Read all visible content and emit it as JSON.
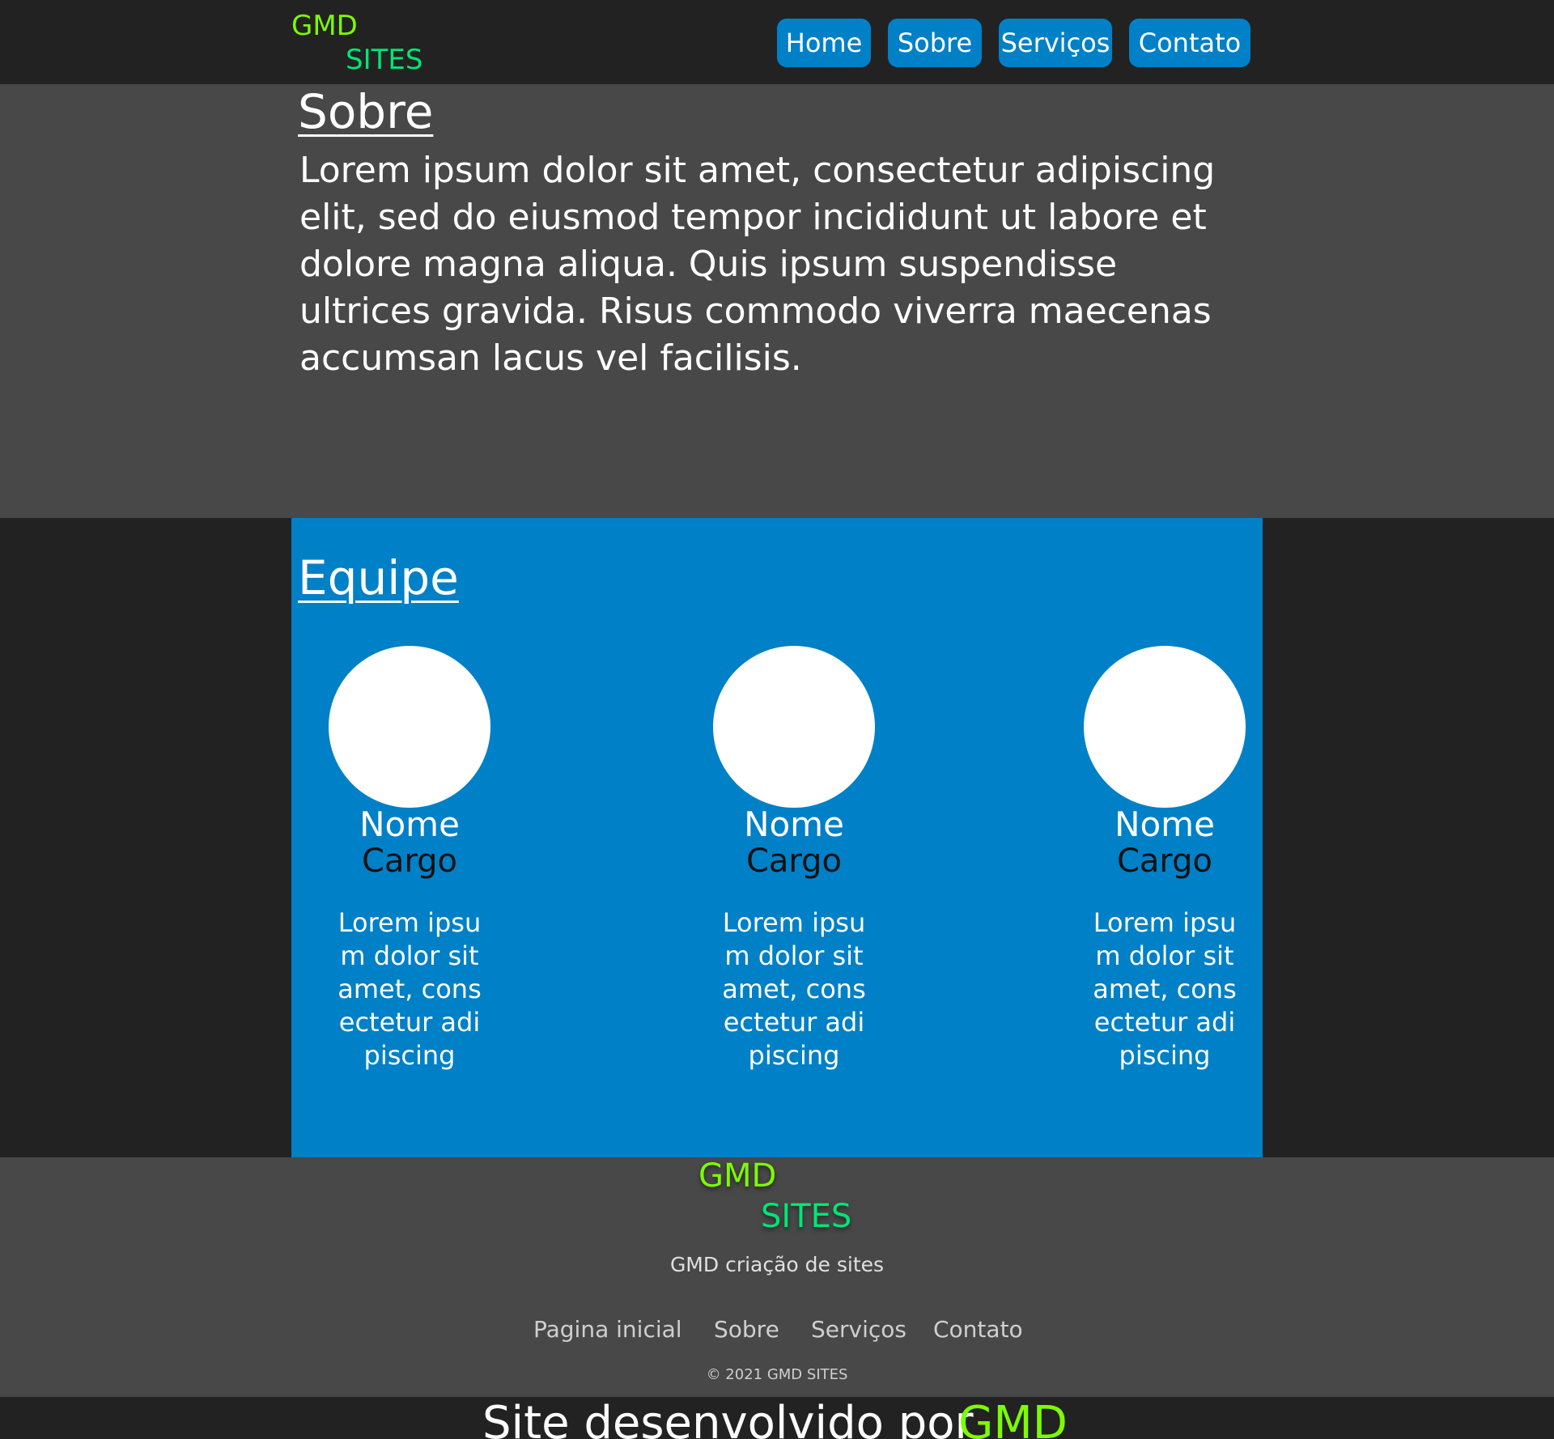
{
  "header": {
    "logo": {
      "line1": "GMD",
      "line2": "SITES"
    },
    "nav": [
      {
        "label": "Home"
      },
      {
        "label": "Sobre"
      },
      {
        "label": "Serviços"
      },
      {
        "label": "Contato"
      }
    ]
  },
  "sobre": {
    "title": "Sobre",
    "text": "Lorem ipsum dolor sit amet, consectetur adipiscing elit, sed do eiusmod tempor incididunt ut labore et dolore magna aliqua. Quis ipsum suspendisse ultrices gravida. Risus commodo viverra maecenas accumsan lacus vel facilisis."
  },
  "equipe": {
    "title": "Equipe",
    "members": [
      {
        "name": "Nome",
        "role": "Cargo",
        "description": "Lorem ipsum dolor sit amet, consectetur adipiscing"
      },
      {
        "name": "Nome",
        "role": "Cargo",
        "description": "Lorem ipsum dolor sit amet, consectetur adipiscing"
      },
      {
        "name": "Nome",
        "role": "Cargo",
        "description": "Lorem ipsum dolor sit amet, consectetur adipiscing"
      }
    ]
  },
  "footer": {
    "logo": {
      "line1": "GMD",
      "line2": "SITES"
    },
    "tagline": "GMD criação de sites",
    "links": [
      {
        "label": "Pagina inicial"
      },
      {
        "label": "Sobre"
      },
      {
        "label": "Serviços"
      },
      {
        "label": "Contato"
      }
    ],
    "copyright": "© 2021 GMD SITES"
  },
  "credit": {
    "text": "Site desenvolvido por",
    "brand": "GMD"
  },
  "colors": {
    "accent_blue": "#0080c7",
    "logo_lime": "#7cfc00",
    "logo_green": "#00e676",
    "dark_bg": "#222222",
    "section_gray": "#484848"
  }
}
